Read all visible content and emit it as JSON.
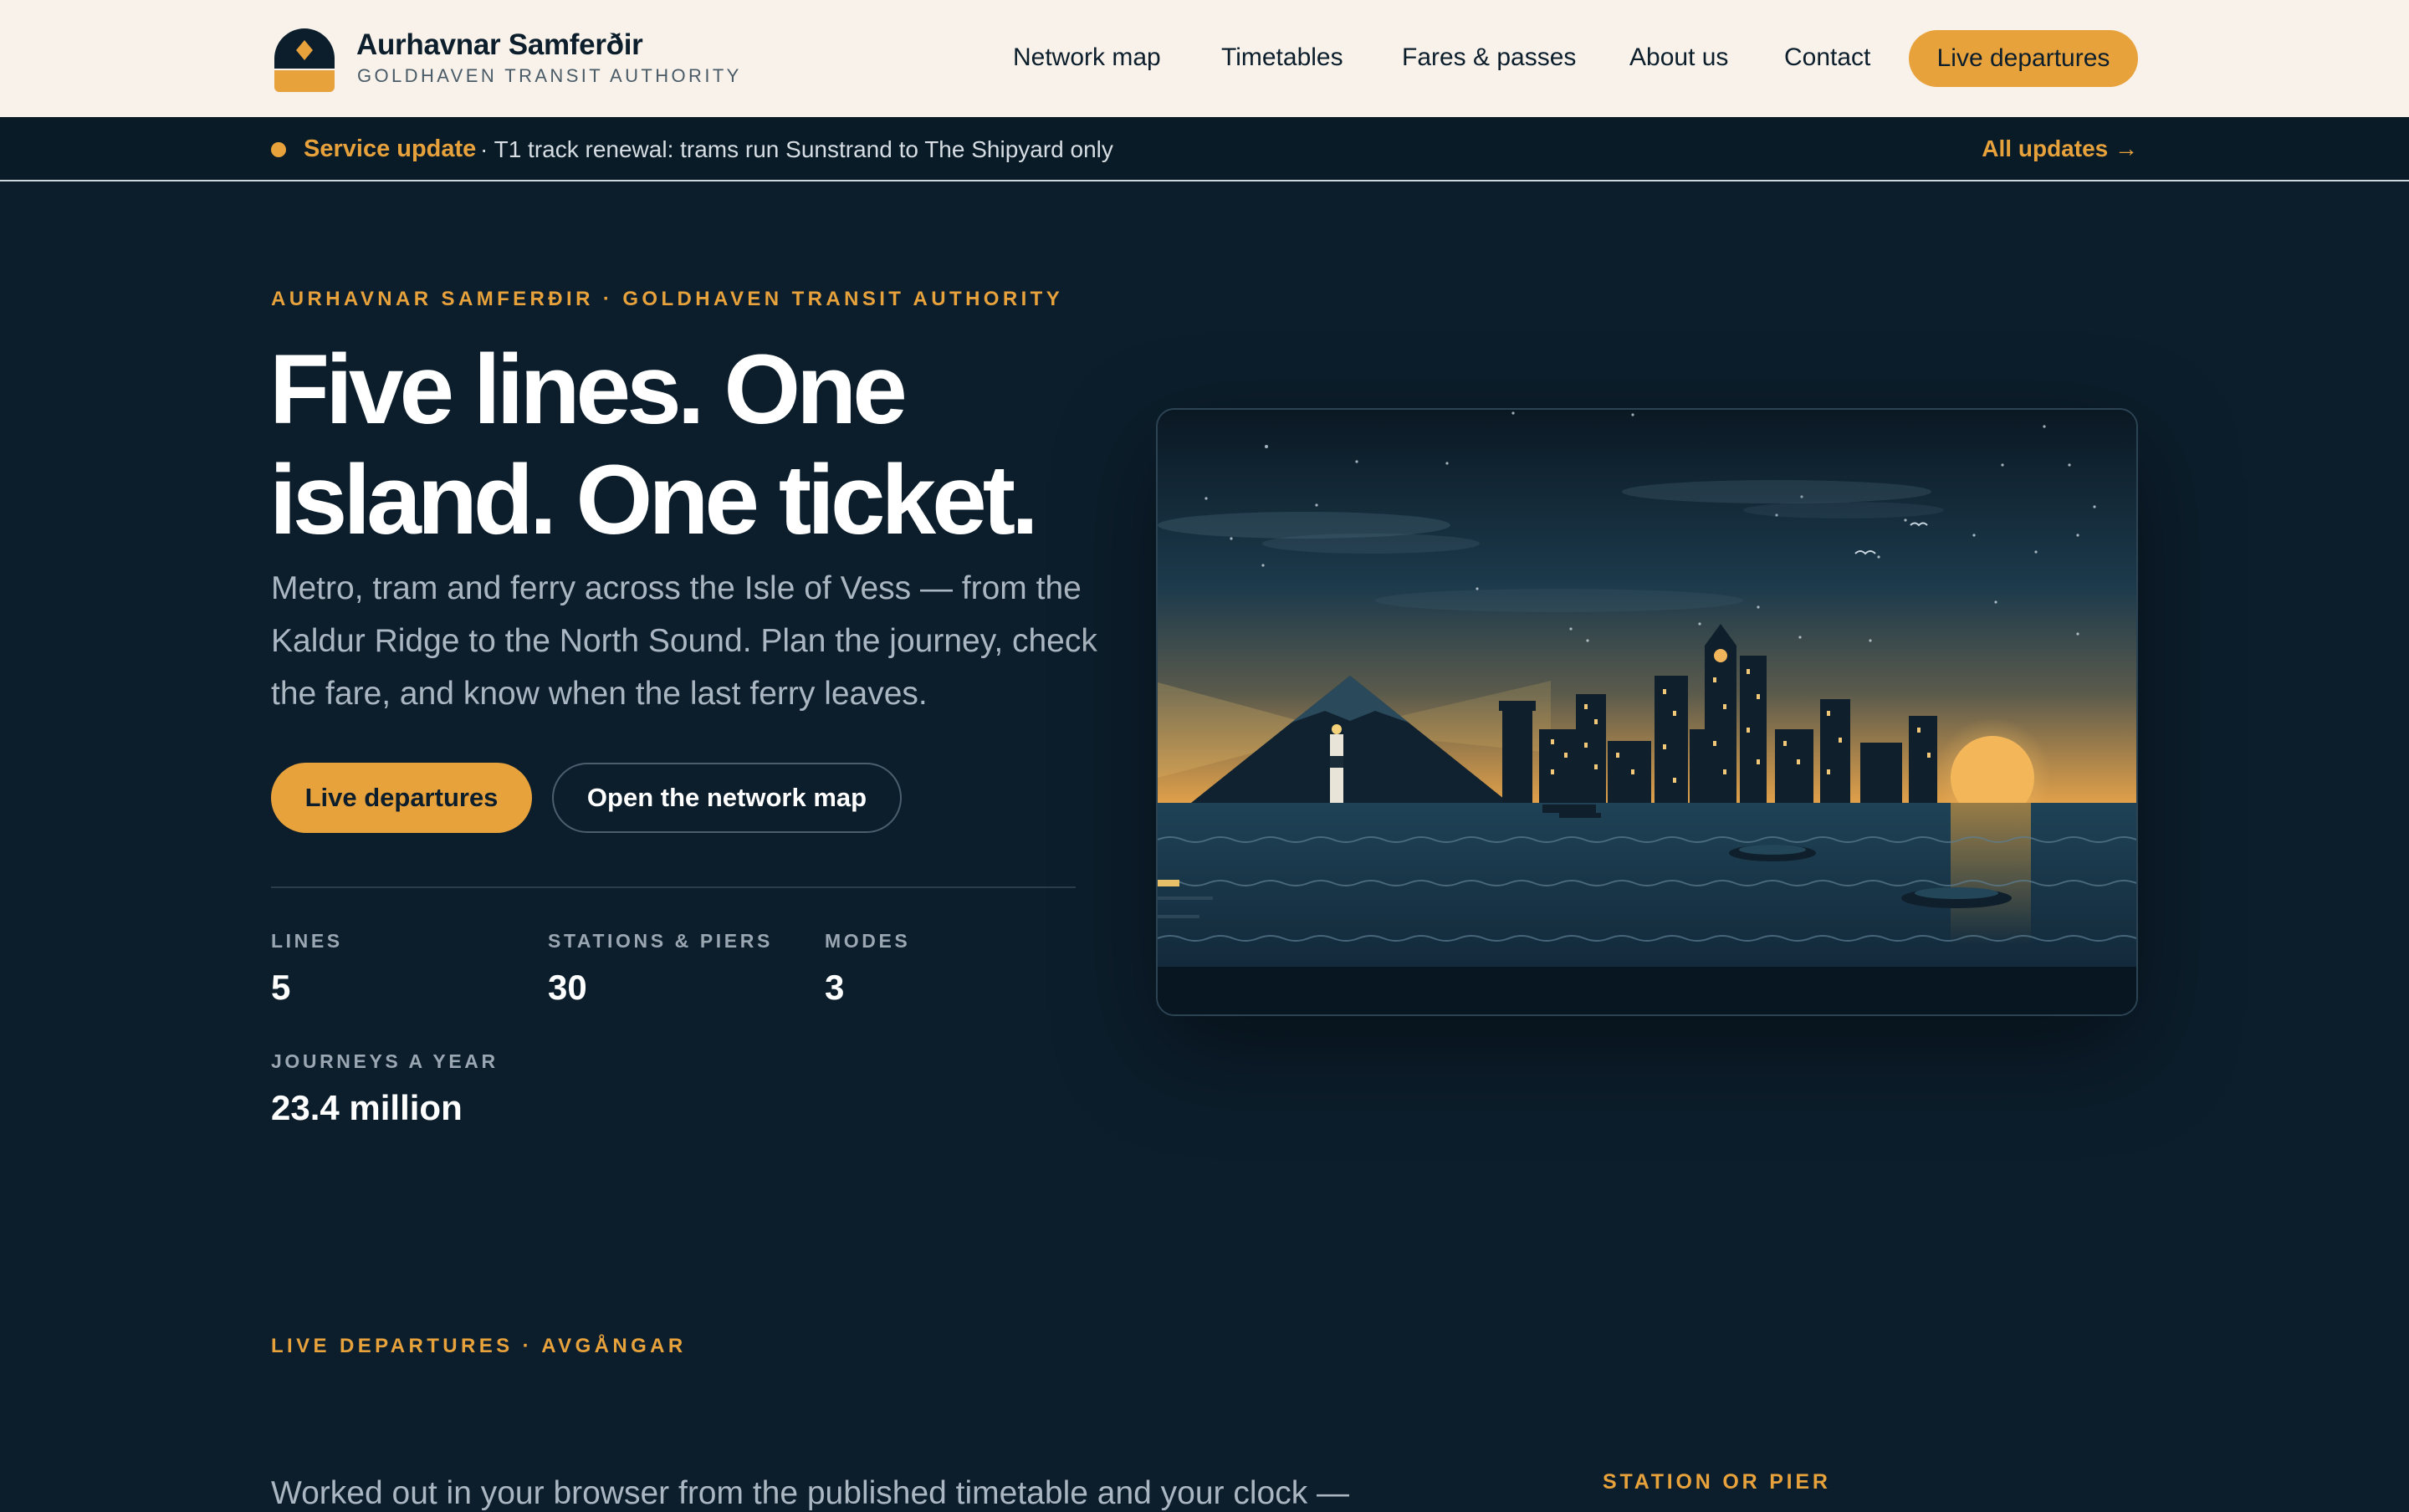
{
  "brand": {
    "name": "Aurhavnar Samferðir",
    "subtitle": "GOLDHAVEN TRANSIT AUTHORITY",
    "logo_icon": "harbour-sun-logo"
  },
  "nav": {
    "items": [
      {
        "label": "Network map"
      },
      {
        "label": "Timetables"
      },
      {
        "label": "Fares & passes"
      },
      {
        "label": "About us"
      },
      {
        "label": "Contact"
      }
    ],
    "cta_label": "Live departures"
  },
  "service_update": {
    "label": "Service update",
    "message": "· T1 track renewal: trams run Sunstrand to The Shipyard only",
    "all_updates": "All updates →"
  },
  "hero": {
    "eyebrow": "AURHAVNAR SAMFERÐIR · GOLDHAVEN TRANSIT AUTHORITY",
    "headline": "Five lines. One island. One ticket.",
    "lede": "Metro, tram and ferry across the Isle of Vess — from the Kaldur Ridge to the North Sound. Plan the journey, check the fare, and know when the last ferry leaves.",
    "primary_button": "Live departures",
    "secondary_button": "Open the network map",
    "stats": [
      {
        "label": "LINES",
        "value": "5"
      },
      {
        "label": "STATIONS & PIERS",
        "value": "30"
      },
      {
        "label": "MODES",
        "value": "3"
      },
      {
        "label": "JOURNEYS A YEAR",
        "value": "23.4 million"
      }
    ]
  },
  "live_departures": {
    "eyebrow": "LIVE DEPARTURES · AVGÅNGAR",
    "lede": "Worked out in your browser from the published timetable and your clock —",
    "station_label": "STATION OR PIER"
  },
  "colors": {
    "accent": "#e8a23c",
    "background": "#0c1e2c",
    "header_bg": "#f8f2ea"
  }
}
